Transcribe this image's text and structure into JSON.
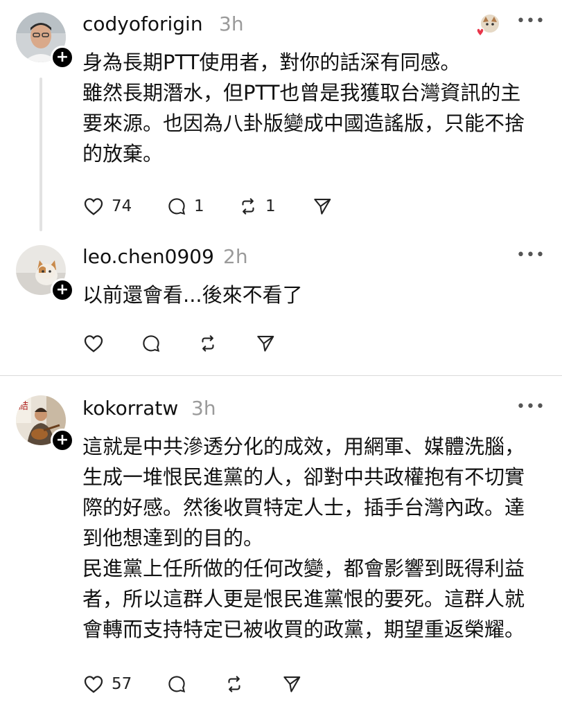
{
  "posts": [
    {
      "username": "codyoforigin",
      "time": "3h",
      "lines": [
        "身為長期PTT使用者，對你的話深有同感。",
        "雖然長期潛水，但PTT也曾是我獲取台灣資訊的主",
        "要來源。也因為八卦版變成中國造謠版，只能不捨",
        "的放棄。"
      ],
      "likes": "74",
      "comments": "1",
      "reposts": "1"
    },
    {
      "username": "leo.chen0909",
      "time": "2h",
      "lines": [
        "以前還會看...後來不看了"
      ],
      "likes": "",
      "comments": "",
      "reposts": ""
    },
    {
      "username": "kokorratw",
      "time": "3h",
      "lines": [
        "這就是中共滲透分化的成效，用網軍、媒體洗腦，",
        "生成一堆恨民進黨的人，卻對中共政權抱有不切實",
        "際的好感。然後收買特定人士，插手台灣內政。達",
        "到他想達到的目的。",
        "民進黨上任所做的任何改變，都會影響到既得利益",
        "者，所以這群人更是恨民進黨恨的要死。這群人就",
        "會轉而支持特定已被收買的政黨，期望重返榮耀。"
      ],
      "likes": "57",
      "comments": "",
      "reposts": ""
    }
  ],
  "icons": {
    "like": "heart-icon",
    "comment": "comment-icon",
    "repost": "repost-icon",
    "share": "send-icon",
    "more": "more-icon",
    "follow": "plus-icon"
  },
  "colors": {
    "like_heart_badge": "#e8364a",
    "muted": "#9a9a9a",
    "divider": "#dadada"
  }
}
